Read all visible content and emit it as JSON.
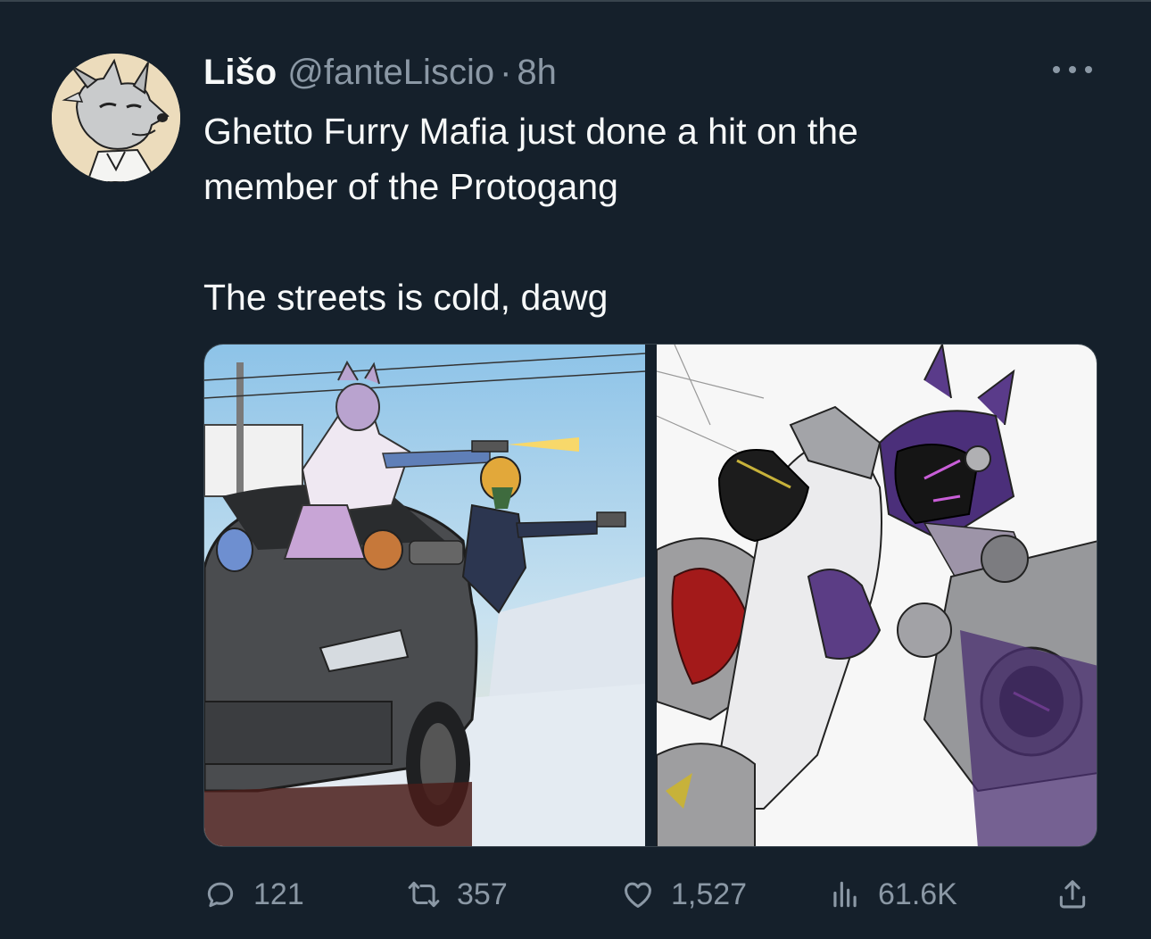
{
  "tweet": {
    "author": {
      "display_name": "Lišo",
      "handle": "@fanteLiscio",
      "separator": "·",
      "time": "8h",
      "avatar_icon": "fox-avatar-illustration"
    },
    "text": "Ghetto Furry Mafia just done a hit on the\nmember of the Protogang\n\nThe streets is cold, dawg",
    "media": [
      {
        "name": "drive-by-car-illustration"
      },
      {
        "name": "protogen-hit-illustration"
      }
    ],
    "metrics": {
      "replies": "121",
      "retweets": "357",
      "likes": "1,527",
      "views": "61.6K"
    },
    "icons": {
      "reply": "speech-bubble-icon",
      "retweet": "retweet-arrows-icon",
      "like": "heart-icon",
      "views": "bar-chart-icon",
      "share": "share-upload-icon",
      "more": "ellipsis-icon"
    }
  },
  "colors": {
    "background": "#15202b",
    "text_primary": "#f7f9f9",
    "text_secondary": "#8b98a5",
    "border": "#38444d"
  }
}
